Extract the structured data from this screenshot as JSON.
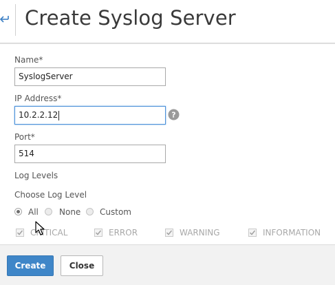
{
  "header": {
    "title": "Create Syslog Server"
  },
  "form": {
    "name": {
      "label": "Name*",
      "value": "SyslogServer"
    },
    "ip": {
      "label": "IP Address*",
      "value": "10.2.2.12"
    },
    "port": {
      "label": "Port*",
      "value": "514"
    },
    "log_levels_heading": "Log Levels",
    "choose_log_level_label": "Choose Log Level",
    "radio_options": [
      {
        "label": "All",
        "selected": true
      },
      {
        "label": "None",
        "selected": false
      },
      {
        "label": "Custom",
        "selected": false
      }
    ],
    "levels": [
      {
        "label": "CRITICAL",
        "checked": true,
        "disabled": true
      },
      {
        "label": "ERROR",
        "checked": true,
        "disabled": true
      },
      {
        "label": "WARNING",
        "checked": true,
        "disabled": true
      },
      {
        "label": "INFORMATION",
        "checked": true,
        "disabled": true
      }
    ]
  },
  "footer": {
    "create_label": "Create",
    "close_label": "Close"
  },
  "colors": {
    "primary_button": "#3f86c8",
    "focus_border": "#4a90d9",
    "back_icon": "#3b7fc4"
  }
}
